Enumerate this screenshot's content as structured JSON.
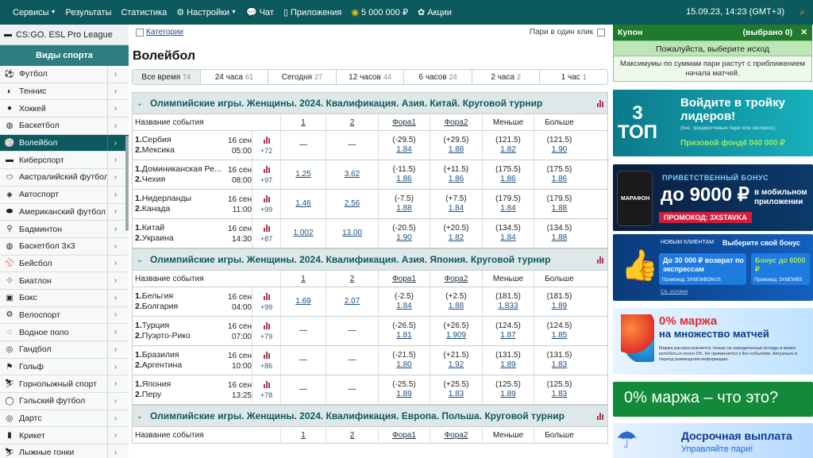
{
  "topbar": {
    "services": "Сервисы",
    "results": "Результаты",
    "statistics": "Статистика",
    "settings": "Настройки",
    "chat": "Чат",
    "apps": "Приложения",
    "bonus": "5 000 000 ₽",
    "promos": "Акции",
    "datetime": "15.09.23, 14:23 (GMT+3)"
  },
  "sidebar": {
    "pinned": "CS:GO. ESL Pro League",
    "header": "Виды спорта",
    "items": [
      {
        "label": "Футбол",
        "icon": "football-icon"
      },
      {
        "label": "Теннис",
        "icon": "tennis-icon"
      },
      {
        "label": "Хоккей",
        "icon": "hockey-icon"
      },
      {
        "label": "Баскетбол",
        "icon": "basketball-icon"
      },
      {
        "label": "Волейбол",
        "icon": "volleyball-icon"
      },
      {
        "label": "Киберспорт",
        "icon": "esports-icon"
      },
      {
        "label": "Австралийский футбол",
        "icon": "aussie-football-icon"
      },
      {
        "label": "Автоспорт",
        "icon": "motorsport-icon"
      },
      {
        "label": "Американский футбол",
        "icon": "american-football-icon"
      },
      {
        "label": "Бадминтон",
        "icon": "badminton-icon"
      },
      {
        "label": "Баскетбол 3x3",
        "icon": "basketball-3x3-icon"
      },
      {
        "label": "Бейсбол",
        "icon": "baseball-icon"
      },
      {
        "label": "Биатлон",
        "icon": "biathlon-icon"
      },
      {
        "label": "Бокс",
        "icon": "boxing-icon"
      },
      {
        "label": "Велоспорт",
        "icon": "cycling-icon"
      },
      {
        "label": "Водное поло",
        "icon": "water-polo-icon"
      },
      {
        "label": "Гандбол",
        "icon": "handball-icon"
      },
      {
        "label": "Гольф",
        "icon": "golf-icon"
      },
      {
        "label": "Горнолыжный спорт",
        "icon": "skiing-icon"
      },
      {
        "label": "Гэльский футбол",
        "icon": "gaelic-football-icon"
      },
      {
        "label": "Дартс",
        "icon": "darts-icon"
      },
      {
        "label": "Крикет",
        "icon": "cricket-icon"
      },
      {
        "label": "Лыжные гонки",
        "icon": "cross-country-icon"
      }
    ]
  },
  "main": {
    "categories": "Категории",
    "one_click": "Пари в один клик",
    "title": "Волейбол",
    "tabs": [
      {
        "label": "Все время",
        "count": "74"
      },
      {
        "label": "24 часа",
        "count": "61"
      },
      {
        "label": "Сегодня",
        "count": "27"
      },
      {
        "label": "12 часов",
        "count": "44"
      },
      {
        "label": "6 часов",
        "count": "24"
      },
      {
        "label": "2 часа",
        "count": "2"
      },
      {
        "label": "1 час",
        "count": "1"
      }
    ],
    "columns": {
      "name": "Название события",
      "c1": "1",
      "c2": "2",
      "c3": "Фора1",
      "c4": "Фора2",
      "c5": "Меньше",
      "c6": "Больше"
    },
    "groups": [
      {
        "title": "Олимпийские игры. Женщины. 2024. Квалификация. Азия. Китай. Круговой турнир",
        "events": [
          {
            "t1": "Сербия",
            "t2": "Мексика",
            "date": "16 сен",
            "time": "05:00",
            "more": "+72",
            "o1": "—",
            "o2": "—",
            "h1": "(-29.5)",
            "h1o": "1.84",
            "h2": "(+29.5)",
            "h2o": "1.88",
            "u": "(121.5)",
            "uo": "1.82",
            "ov": "(121.5)",
            "ovo": "1.90"
          },
          {
            "t1": "Доминиканская Ре...",
            "t2": "Чехия",
            "date": "16 сен",
            "time": "08:00",
            "more": "+97",
            "o1": "1.25",
            "o2": "3.62",
            "h1": "(-11.5)",
            "h1o": "1.86",
            "h2": "(+11.5)",
            "h2o": "1.86",
            "u": "(175.5)",
            "uo": "1.86",
            "ov": "(175.5)",
            "ovo": "1.86"
          },
          {
            "t1": "Нидерланды",
            "t2": "Канада",
            "date": "16 сен",
            "time": "11:00",
            "more": "+99",
            "o1": "1.46",
            "o2": "2.56",
            "h1": "(-7.5)",
            "h1o": "1.88",
            "h2": "(+7.5)",
            "h2o": "1.84",
            "u": "(179.5)",
            "uo": "1.84",
            "ov": "(179.5)",
            "ovo": "1.88"
          },
          {
            "t1": "Китай",
            "t2": "Украина",
            "date": "16 сен",
            "time": "14:30",
            "more": "+87",
            "o1": "1.002",
            "o2": "13.00",
            "h1": "(-20.5)",
            "h1o": "1.90",
            "h2": "(+20.5)",
            "h2o": "1.82",
            "u": "(134.5)",
            "uo": "1.84",
            "ov": "(134.5)",
            "ovo": "1.88"
          }
        ]
      },
      {
        "title": "Олимпийские игры. Женщины. 2024. Квалификация. Азия. Япония. Круговой турнир",
        "events": [
          {
            "t1": "Бельгия",
            "t2": "Болгария",
            "date": "16 сен",
            "time": "04:00",
            "more": "+99",
            "o1": "1.69",
            "o2": "2.07",
            "h1": "(-2.5)",
            "h1o": "1.84",
            "h2": "(+2.5)",
            "h2o": "1.88",
            "u": "(181.5)",
            "uo": "1.833",
            "ov": "(181.5)",
            "ovo": "1.89"
          },
          {
            "t1": "Турция",
            "t2": "Пуэрто-Рико",
            "date": "16 сен",
            "time": "07:00",
            "more": "+79",
            "o1": "—",
            "o2": "—",
            "h1": "(-26.5)",
            "h1o": "1.81",
            "h2": "(+26.5)",
            "h2o": "1.909",
            "u": "(124.5)",
            "uo": "1.87",
            "ov": "(124.5)",
            "ovo": "1.85"
          },
          {
            "t1": "Бразилия",
            "t2": "Аргентина",
            "date": "16 сен",
            "time": "10:00",
            "more": "+86",
            "o1": "—",
            "o2": "—",
            "h1": "(-21.5)",
            "h1o": "1.80",
            "h2": "(+21.5)",
            "h2o": "1.92",
            "u": "(131.5)",
            "uo": "1.89",
            "ov": "(131.5)",
            "ovo": "1.83"
          },
          {
            "t1": "Япония",
            "t2": "Перу",
            "date": "16 сен",
            "time": "13:25",
            "more": "+78",
            "o1": "—",
            "o2": "—",
            "h1": "(-25.5)",
            "h1o": "1.89",
            "h2": "(+25.5)",
            "h2o": "1.83",
            "u": "(125.5)",
            "uo": "1.89",
            "ov": "(125.5)",
            "ovo": "1.83"
          }
        ]
      },
      {
        "title": "Олимпийские игры. Женщины. 2024. Квалификация. Европа. Польша. Круговой турнир",
        "events": []
      }
    ]
  },
  "coupon": {
    "title": "Купон",
    "count": "(выбрано 0)",
    "select_prompt": "Пожалуйста, выберите исход",
    "info": "Максимумы по суммам пари растут с приближением начала матчей."
  },
  "banners": {
    "b1_line1": "Войдите в тройку",
    "b1_line2": "лидеров!",
    "b1_small": "(live, предматчевые пари или экспресс)",
    "b1_badge": "3 ТОП",
    "b1_fund": "Призовой фонд",
    "b1_amount": "4 040 000 ₽",
    "b2_top": "ПРИВЕТСТВЕННЫЙ БОНУС",
    "b2_amount": "до 9000 ₽",
    "b2_side": "в мобильном приложении",
    "b2_promo": "ПРОМОКОД: 3XSTAVKA",
    "b2_brand": "МАРАФОН",
    "b3_tag": "НОВЫМ КЛИЕНТАМ",
    "b3_choose": "Выберите свой бонус",
    "b3_left": "До 30 000 ₽ возврат по экспрессам",
    "b3_left_code": "Промокод: 3XNEWBONUS",
    "b3_right": "Бонус до 6000 ₽",
    "b3_right_code": "Промокод: 3XNEWBS",
    "b3_terms": "См. условия",
    "b4_line1": "0% маржа",
    "b4_line2": "на множество матчей",
    "b4_small": "Маржа распространяется только на определенные исходы и может колебаться около 0%. Не применяется к live-событиям. Актуально в период размещения информации.",
    "b5_text": "0% маржа – что это?",
    "b6_line1": "Досрочная выплата",
    "b6_line2": "Управляйте пари!"
  }
}
